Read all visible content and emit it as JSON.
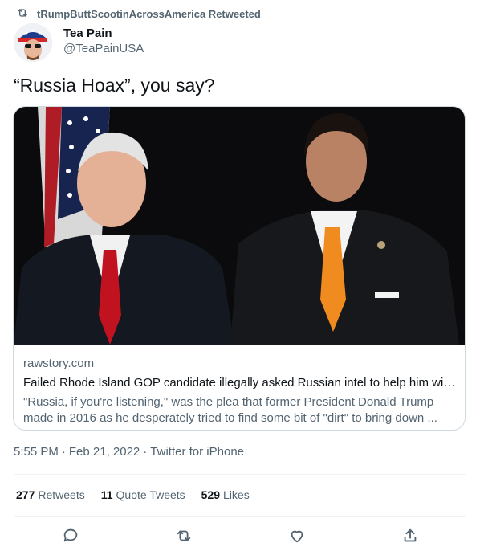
{
  "retweet_banner": {
    "text": "tRumpButtScootinAcrossAmerica Retweeted",
    "icon": "retweet-icon"
  },
  "author": {
    "name": "Tea Pain",
    "handle": "@TeaPainUSA",
    "avatar_icon": "avatar"
  },
  "tweet": {
    "text": "“Russia Hoax”, you say?"
  },
  "link_card": {
    "domain": "rawstory.com",
    "title": "Failed Rhode Island GOP candidate illegally asked Russian intel to help him win...",
    "description": "\"Russia, if you're listening,\" was the plea that former President Donald Trump made in 2016 as he desperately tried to find some bit of \"dirt\" to bring down ..."
  },
  "meta": {
    "time": "5:55 PM",
    "sep1": "·",
    "date": "Feb 21, 2022",
    "sep2": "·",
    "source": "Twitter for iPhone"
  },
  "stats": {
    "retweets_count": "277",
    "retweets_label": "Retweets",
    "quotes_count": "11",
    "quotes_label": "Quote Tweets",
    "likes_count": "529",
    "likes_label": "Likes"
  },
  "actions": [
    "reply-icon",
    "retweet-icon",
    "like-icon",
    "share-icon"
  ],
  "colors": {
    "text": "#0f1419",
    "secondary": "#536471",
    "border": "#cfd9de",
    "orange_tie": "#f08b1f",
    "red_tie": "#c1121f"
  }
}
